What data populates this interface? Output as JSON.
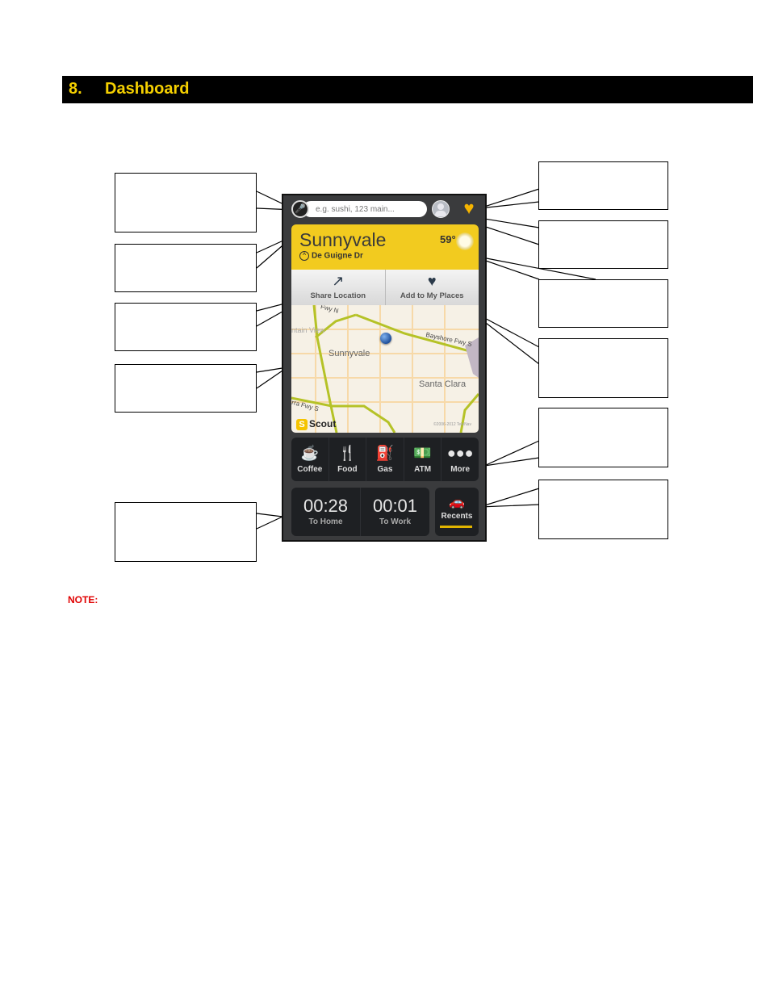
{
  "section": {
    "number": "8.",
    "title": "Dashboard"
  },
  "note_label": "NOTE:",
  "colors": {
    "header_bg": "#000000",
    "header_text": "#f5d000",
    "note": "#e00000",
    "accent_yellow": "#f2cb1f"
  },
  "app": {
    "search": {
      "placeholder": "e.g. sushi, 123 main...",
      "mic_icon": "microphone-icon"
    },
    "profile_icon": "profile-icon",
    "favorites_icon": "heart-icon",
    "location": {
      "city": "Sunnyvale",
      "street": "De Guigne Dr",
      "temperature": "59°",
      "weather_icon": "sun-icon"
    },
    "actions": [
      {
        "label": "Share Location",
        "icon": "share-icon"
      },
      {
        "label": "Add to My Places",
        "icon": "heart-icon"
      }
    ],
    "map": {
      "labels": [
        "Sunnyvale",
        "Santa Clara",
        "Bayshore Fwy S",
        "ntain View",
        "Fwy N",
        "rra Fwy S"
      ],
      "brand": "Scout",
      "copyright": "©2006-2012 TeleNav"
    },
    "categories": [
      {
        "label": "Coffee",
        "icon": "coffee-icon"
      },
      {
        "label": "Food",
        "icon": "fork-knife-icon"
      },
      {
        "label": "Gas",
        "icon": "gas-pump-icon"
      },
      {
        "label": "ATM",
        "icon": "atm-icon"
      },
      {
        "label": "More",
        "icon": "more-icon"
      }
    ],
    "eta": [
      {
        "time": "00:28",
        "label": "To Home"
      },
      {
        "time": "00:01",
        "label": "To Work"
      }
    ],
    "recents": {
      "label": "Recents",
      "icon": "car-icon"
    }
  },
  "callouts_left": [
    "",
    "",
    "",
    "",
    ""
  ],
  "callouts_right": [
    "",
    "",
    "",
    "",
    "",
    ""
  ]
}
